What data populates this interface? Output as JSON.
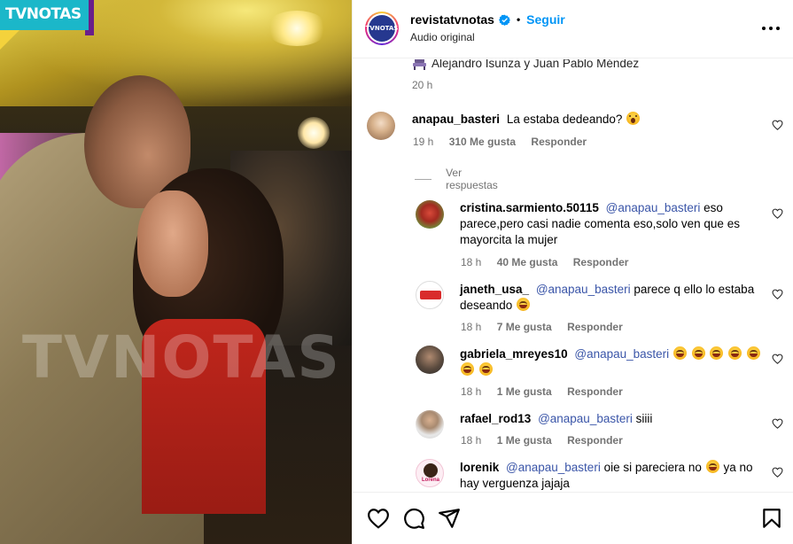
{
  "media": {
    "logo_text": "TVNOTAS",
    "watermark_text": "TVNOTAS"
  },
  "header": {
    "avatar_text": "TVNOTAS",
    "username": "revistatvnotas",
    "separator": "•",
    "follow_label": "Seguir",
    "audio_label": "Audio original"
  },
  "caption": {
    "text": "Alejandro Isunza y Juan Pablo Méndez",
    "timestamp": "20 h"
  },
  "comments": [
    {
      "username": "anapau_basteri",
      "text": "La estaba dedeando?",
      "emoji": "shock",
      "time": "19 h",
      "likes": "310 Me gusta",
      "reply_label": "Responder",
      "view_replies": "Ver respuestas"
    },
    {
      "username": "cristina.sarmiento.50115",
      "mention": "@anapau_basteri",
      "text": "eso parece,pero casi nadie comenta eso,solo ven que es mayorcita la mujer",
      "time": "18 h",
      "likes": "40 Me gusta",
      "reply_label": "Responder"
    },
    {
      "username": "janeth_usa_",
      "mention": "@anapau_basteri",
      "text": "parece q ello lo estaba deseando",
      "time": "18 h",
      "likes": "7 Me gusta",
      "reply_label": "Responder"
    },
    {
      "username": "gabriela_mreyes10",
      "mention": "@anapau_basteri",
      "text": "",
      "time": "18 h",
      "likes": "1 Me gusta",
      "reply_label": "Responder"
    },
    {
      "username": "rafael_rod13",
      "mention": "@anapau_basteri",
      "text": "siiii",
      "time": "18 h",
      "likes": "1 Me gusta",
      "reply_label": "Responder"
    },
    {
      "username": "lorenik",
      "mention": "@anapau_basteri",
      "text_before": "oie si pareciera no",
      "text_after": "ya no hay verguenza jajaja",
      "avatar_text": "Lorena"
    }
  ],
  "icons": {
    "more": "more-icon",
    "like": "heart-icon",
    "comment": "comment-icon",
    "share": "share-icon",
    "save": "bookmark-icon",
    "verified": "verified-badge-icon"
  },
  "colors": {
    "follow": "#0095f6",
    "mention": "#3a55a8",
    "meta": "#737373"
  }
}
